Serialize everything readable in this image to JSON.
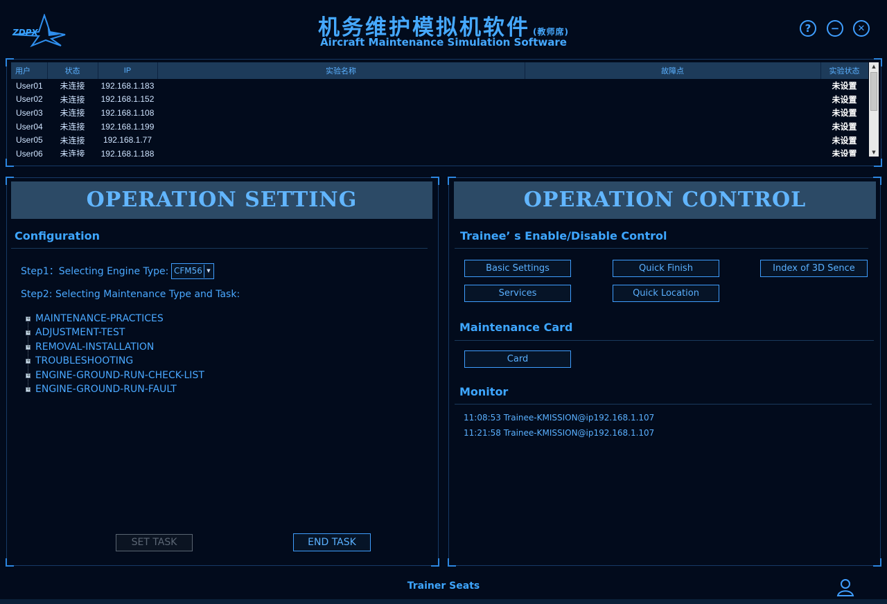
{
  "header": {
    "logo_text": "ZDPX",
    "title_cn": "机务维护模拟机软件",
    "title_cn_sub": "(教师席)",
    "title_en": "Aircraft Maintenance Simulation Software",
    "help_symbol": "?",
    "minimize_symbol": "−",
    "close_symbol": "✕"
  },
  "table": {
    "columns": [
      "用户",
      "状态",
      "IP",
      "实验名称",
      "故障点",
      "实验状态"
    ],
    "rows": [
      {
        "user": "User01",
        "status": "未连接",
        "ip": "192.168.1.183",
        "experiment": "",
        "fault": "",
        "exp_status": "未设置"
      },
      {
        "user": "User02",
        "status": "未连接",
        "ip": "192.168.1.152",
        "experiment": "",
        "fault": "",
        "exp_status": "未设置"
      },
      {
        "user": "User03",
        "status": "未连接",
        "ip": "192.168.1.108",
        "experiment": "",
        "fault": "",
        "exp_status": "未设置"
      },
      {
        "user": "User04",
        "status": "未连接",
        "ip": "192.168.1.199",
        "experiment": "",
        "fault": "",
        "exp_status": "未设置"
      },
      {
        "user": "User05",
        "status": "未连接",
        "ip": "192.168.1.77",
        "experiment": "",
        "fault": "",
        "exp_status": "未设置"
      },
      {
        "user": "User06",
        "status": "未连接",
        "ip": "192.168.1.188",
        "experiment": "",
        "fault": "",
        "exp_status": "未设置"
      }
    ]
  },
  "setting": {
    "title": "OPERATION SETTING",
    "section": "Configuration",
    "step1_label": "Step1：Selecting Engine Type:",
    "engine_type": "CFM56",
    "step2_label": "Step2: Selecting Maintenance Type and Task:",
    "tree": [
      "MAINTENANCE-PRACTICES",
      "ADJUSTMENT-TEST",
      "REMOVAL-INSTALLATION",
      "TROUBLESHOOTING",
      "ENGINE-GROUND-RUN-CHECK-LIST",
      "ENGINE-GROUND-RUN-FAULT"
    ],
    "set_task": "SET  TASK",
    "end_task": "END  TASK"
  },
  "control": {
    "title": "OPERATION CONTROL",
    "section_enable": "Trainee’ s Enable/Disable Control",
    "buttons": {
      "basic_settings": "Basic Settings",
      "quick_finish": "Quick Finish",
      "index_3d": "Index of 3D Sence",
      "services": "Services",
      "quick_location": "Quick Location"
    },
    "section_card": "Maintenance Card",
    "card_button": "Card",
    "section_monitor": "Monitor",
    "monitor_log": [
      "11:08:53  Trainee-KMISSION@ip192.168.1.107",
      "11:21:58  Trainee-KMISSION@ip192.168.1.107"
    ]
  },
  "footer": {
    "text": "Trainer Seats"
  },
  "colors": {
    "background": "#020b1c",
    "accent": "#3f9eff",
    "panel_header": "#2c4a66"
  }
}
